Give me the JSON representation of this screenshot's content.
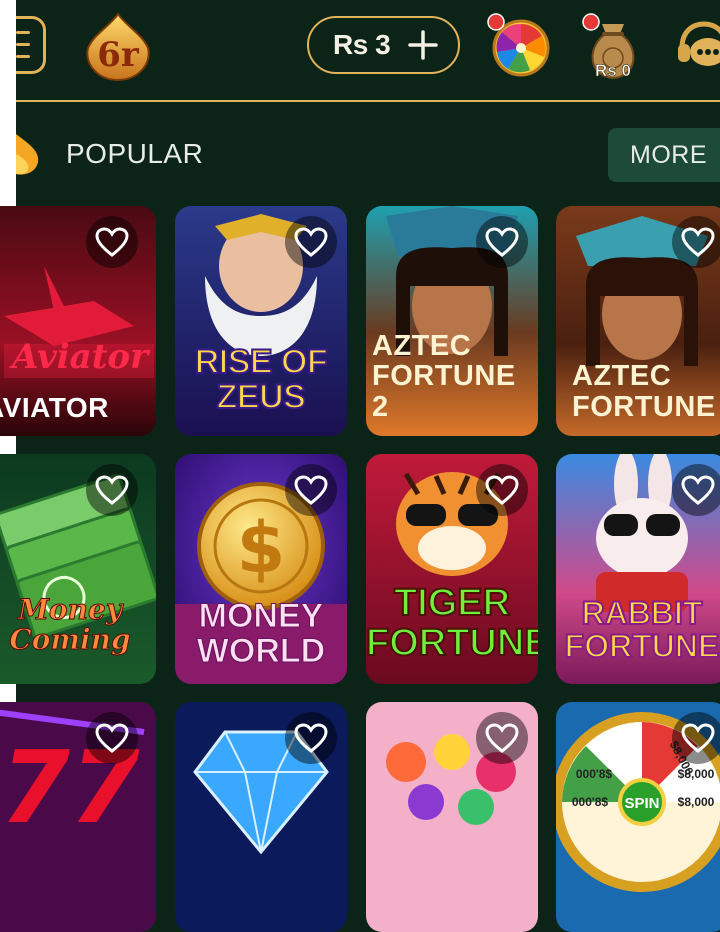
{
  "header": {
    "balance": "Rs 3",
    "bag_amount": "Rs 0",
    "logo_text": "6r"
  },
  "section": {
    "title": "POPULAR",
    "more_label": "MORE"
  },
  "games": [
    {
      "title": "AVIATOR",
      "logo": "Aviator"
    },
    {
      "title": "RISE OF ZEUS"
    },
    {
      "title": "AZTEC FORTUNE 2"
    },
    {
      "title": "AZTEC FORTUNE"
    },
    {
      "title": "Money Coming"
    },
    {
      "title": "MONEY WORLD"
    },
    {
      "title": "TIGER FORTUNE"
    },
    {
      "title": "RABBIT FORTUNE"
    },
    {
      "title": ""
    },
    {
      "title": ""
    },
    {
      "title": ""
    },
    {
      "title": "",
      "wheel_center": "SPIN",
      "wheel_labels": [
        "$8,000",
        "$8,000",
        "000'8$",
        "000'8$",
        "$8,000"
      ]
    }
  ],
  "colors": {
    "background": "#0c2418",
    "accent_gold": "#e0b25a",
    "more_button": "#1e4a38"
  }
}
